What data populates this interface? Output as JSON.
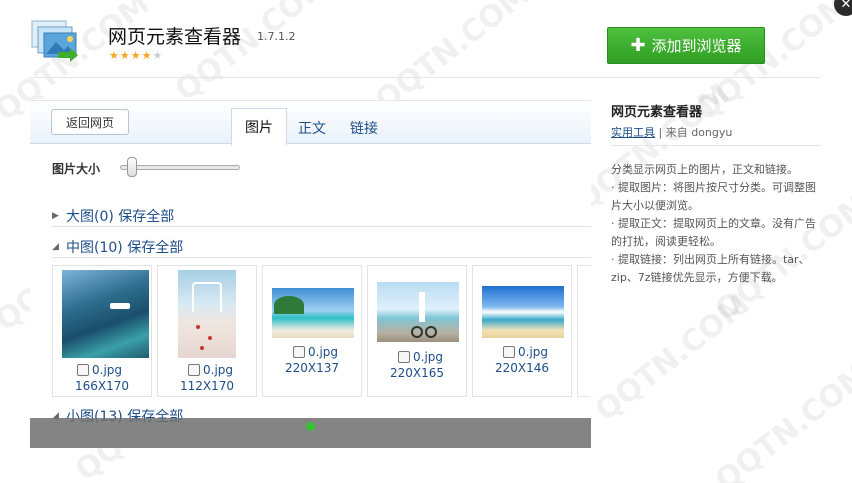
{
  "app": {
    "title": "网页元素查看器",
    "version": "1.7.1.2",
    "rating_stars": 4,
    "rating_max": 5,
    "add_button_label": "添加到浏览器"
  },
  "preview": {
    "back_label": "返回网页",
    "tabs": [
      {
        "label": "图片",
        "active": true
      },
      {
        "label": "正文",
        "active": false
      },
      {
        "label": "链接",
        "active": false
      }
    ],
    "size_label": "图片大小",
    "slider_value": 0.1,
    "sections": {
      "large": {
        "label": "大图(0) 保存全部",
        "expanded": false
      },
      "medium": {
        "label": "中图(10) 保存全部",
        "expanded": true
      },
      "small": {
        "label": "小图(13) 保存全部",
        "expanded": true
      }
    },
    "images": [
      {
        "name": "0.jpg",
        "size": "166X170"
      },
      {
        "name": "0.jpg",
        "size": "112X170"
      },
      {
        "name": "0.jpg",
        "size": "220X137"
      },
      {
        "name": "0.jpg",
        "size": "220X165"
      },
      {
        "name": "0.jpg",
        "size": "220X146"
      }
    ]
  },
  "info": {
    "title": "网页元素查看器",
    "category_link": "实用工具",
    "author_prefix": " | 来自 ",
    "author": "dongyu",
    "description": [
      "分类显示网页上的图片，正文和链接。",
      "· 提取图片：将图片按尺寸分类。可调整图片大小以便浏览。",
      "· 提取正文：提取网页上的文章。没有广告的打扰，阅读更轻松。",
      "· 提取链接：列出网页上所有链接。tar、zip、7z链接优先显示，方便下载。"
    ]
  },
  "watermark": "QQTN.COM",
  "colors": {
    "accent": "#2f9e22",
    "link": "#1d4e89",
    "star": "#f5a623"
  }
}
